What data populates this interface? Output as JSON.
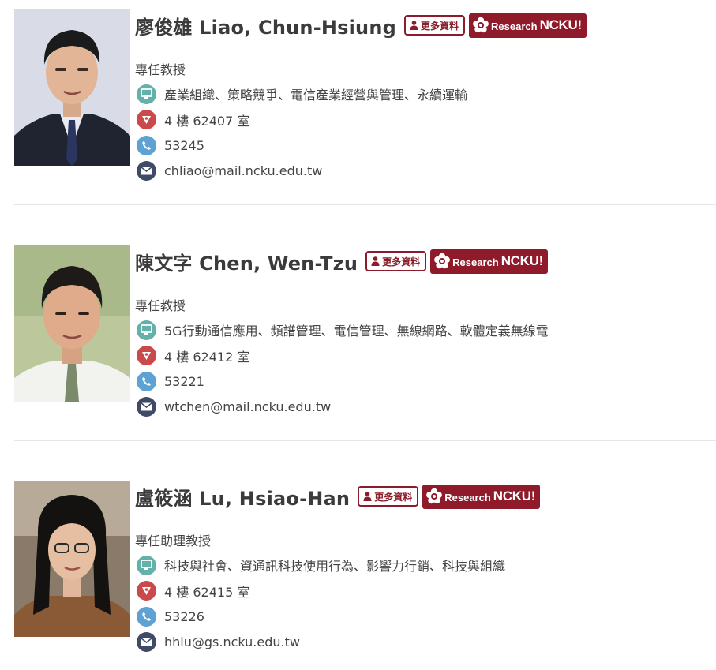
{
  "faculty": [
    {
      "name": "廖俊雄 Liao, Chun-Hsiung",
      "more_label": "更多資料",
      "research_label": "Research",
      "ncku_label": "NCKU!",
      "title": "專任教授",
      "research_areas": "產業組織、策略競爭、電信產業經營與管理、永續運輸",
      "office": "4 樓 62407 室",
      "phone": "53245",
      "email": "chliao@mail.ncku.edu.tw"
    },
    {
      "name": "陳文字 Chen, Wen-Tzu",
      "more_label": "更多資料",
      "research_label": "Research",
      "ncku_label": "NCKU!",
      "title": "專任教授",
      "research_areas": "5G行動通信應用、頻譜管理、電信管理、無線網路、軟體定義無線電",
      "office": "4 樓 62412 室",
      "phone": "53221",
      "email": "wtchen@mail.ncku.edu.tw"
    },
    {
      "name": "盧筱涵 Lu, Hsiao-Han",
      "more_label": "更多資料",
      "research_label": "Research",
      "ncku_label": "NCKU!",
      "title": "專任助理教授",
      "research_areas": "科技與社會、資通訊科技使用行為、影響力行銷、科技與組織",
      "office": "4 樓 62415 室",
      "phone": "53226",
      "email": "hhlu@gs.ncku.edu.tw"
    }
  ],
  "colors": {
    "brand": "#8f1a2a",
    "monitor_icon": "#63b1a8",
    "location_icon": "#c94a4a",
    "phone_icon": "#5da2d3",
    "mail_icon": "#3f4a66"
  },
  "icons": [
    "person-icon",
    "flower-logo-icon",
    "monitor-icon",
    "location-icon",
    "phone-icon",
    "mail-icon"
  ]
}
